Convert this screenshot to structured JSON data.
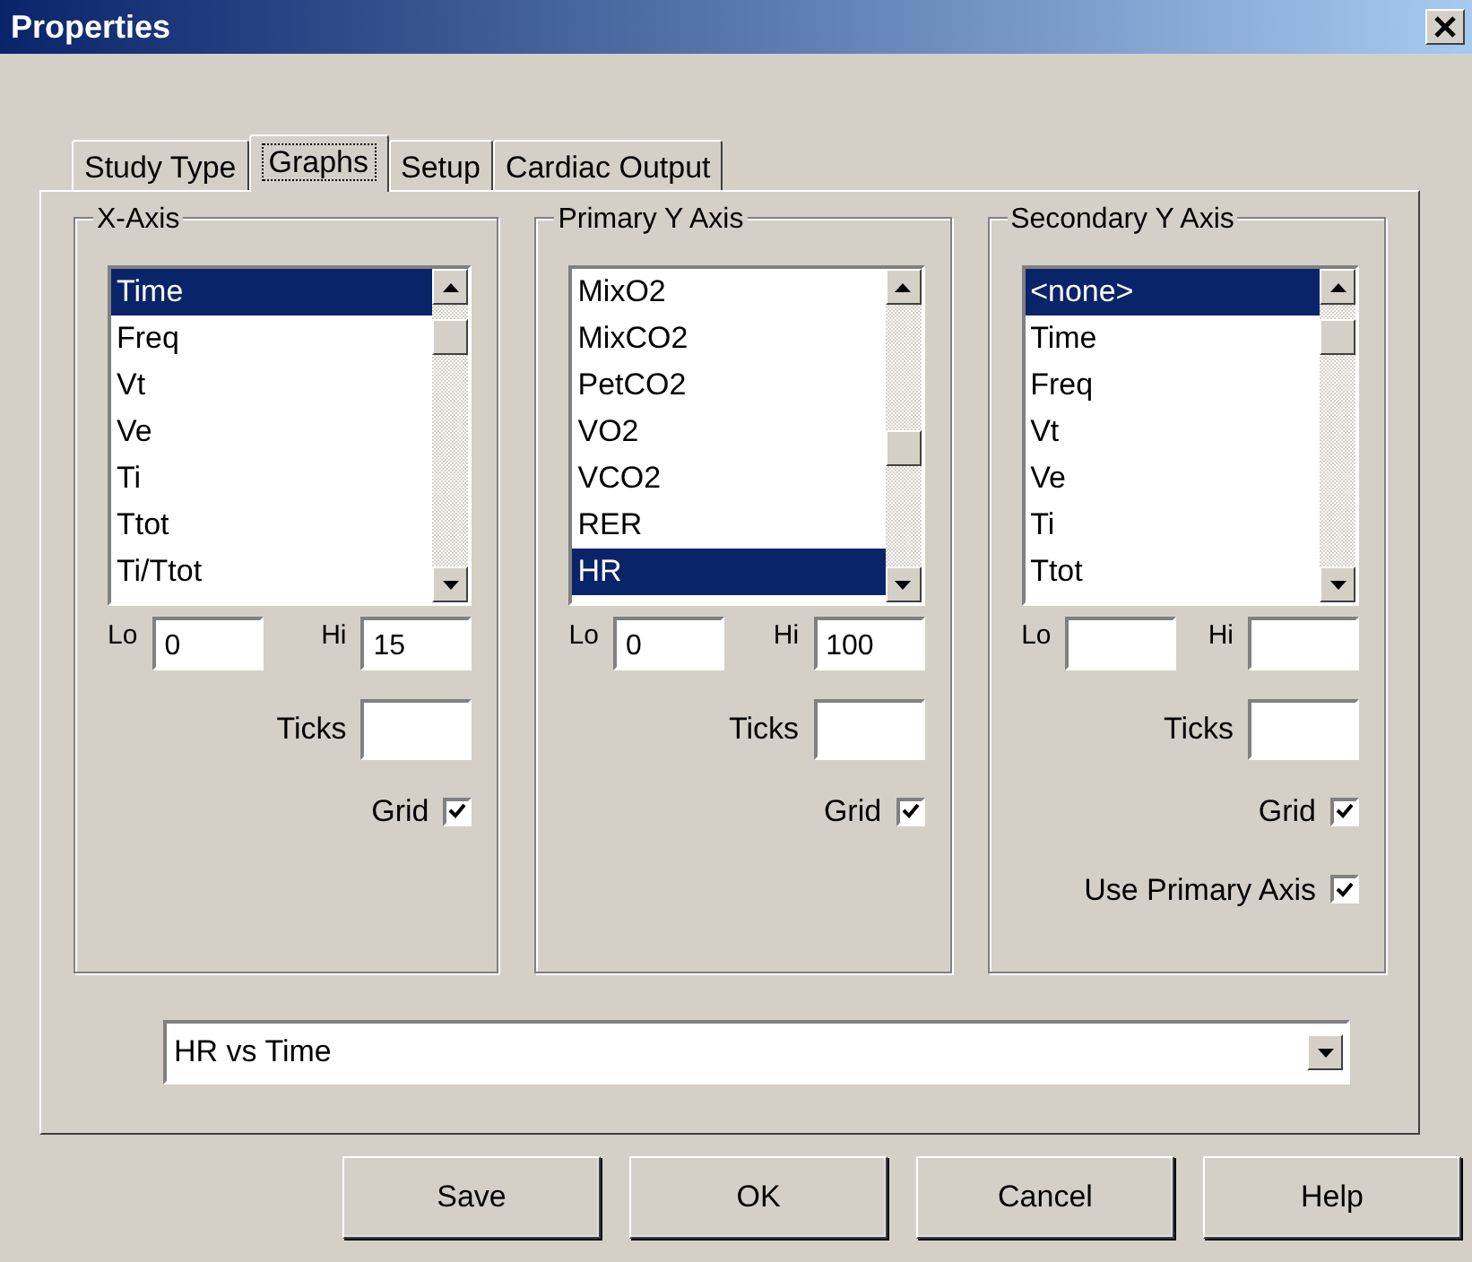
{
  "window": {
    "title": "Properties"
  },
  "tabs": [
    {
      "label": "Study Type",
      "selected": false
    },
    {
      "label": "Graphs",
      "selected": true
    },
    {
      "label": "Setup",
      "selected": false
    },
    {
      "label": "Cardiac Output",
      "selected": false
    }
  ],
  "groups": [
    {
      "title": "X-Axis",
      "items": [
        {
          "label": "Time",
          "selected": true
        },
        {
          "label": "Freq",
          "selected": false
        },
        {
          "label": "Vt",
          "selected": false
        },
        {
          "label": "Ve",
          "selected": false
        },
        {
          "label": "Ti",
          "selected": false
        },
        {
          "label": "Ttot",
          "selected": false
        },
        {
          "label": "Ti/Ttot",
          "selected": false
        }
      ],
      "fields": [
        {
          "label": "Lo",
          "value": "0"
        },
        {
          "label": "Hi",
          "value": "15"
        }
      ],
      "ticks": {
        "label": "Ticks"
      },
      "checkboxes": [
        {
          "label": "Grid",
          "checked": true
        }
      ]
    },
    {
      "title": "Primary Y Axis",
      "items": [
        {
          "label": "MixO2",
          "selected": false
        },
        {
          "label": "MixCO2",
          "selected": false
        },
        {
          "label": "PetCO2",
          "selected": false
        },
        {
          "label": "VO2",
          "selected": false
        },
        {
          "label": "VCO2",
          "selected": false
        },
        {
          "label": "RER",
          "selected": false
        },
        {
          "label": "HR",
          "selected": true
        }
      ],
      "fields": [
        {
          "label": "Lo",
          "value": "0"
        },
        {
          "label": "Hi",
          "value": "100"
        }
      ],
      "ticks": {
        "label": "Ticks"
      },
      "checkboxes": [
        {
          "label": "Grid",
          "checked": true
        }
      ]
    },
    {
      "title": "Secondary Y Axis",
      "items": [
        {
          "label": "<none>",
          "selected": true
        },
        {
          "label": "Time",
          "selected": false
        },
        {
          "label": "Freq",
          "selected": false
        },
        {
          "label": "Vt",
          "selected": false
        },
        {
          "label": "Ve",
          "selected": false
        },
        {
          "label": "Ti",
          "selected": false
        },
        {
          "label": "Ttot",
          "selected": false
        }
      ],
      "fields": [
        {
          "label": "Lo"
        },
        {
          "label": "Hi"
        }
      ],
      "ticks": {
        "label": "Ticks"
      },
      "checkboxes": [
        {
          "label": "Grid",
          "checked": true
        },
        {
          "label": "Use Primary Axis",
          "checked": true
        }
      ]
    }
  ],
  "graph_select": {
    "value": "HR vs Time"
  },
  "buttons": [
    "Save",
    "OK",
    "Cancel",
    "Help"
  ]
}
